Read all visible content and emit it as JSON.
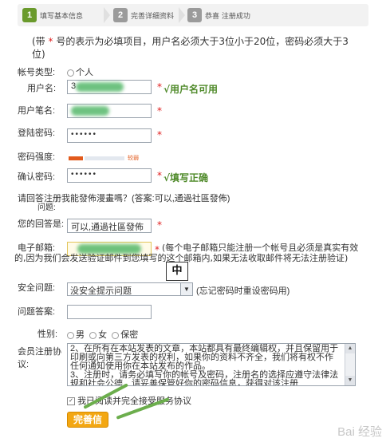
{
  "steps": [
    {
      "num": "1",
      "label": "填写基本信息",
      "state": "active"
    },
    {
      "num": "2",
      "label": "完善详细资料",
      "state": "pending"
    },
    {
      "num": "3",
      "label": "恭喜  注册成功",
      "state": "pending"
    }
  ],
  "note": {
    "before": "(带 ",
    "star": "*",
    "after": " 号的表示为必填项目，用户名必须大于3位小于20位，密码必须大于3位)"
  },
  "account_type": {
    "label": "帐号类型:",
    "value": "个人"
  },
  "username": {
    "label": "用户名:",
    "value": "3",
    "required": "*",
    "status": "√用户名可用"
  },
  "nickname": {
    "label": "用户笔名:",
    "required": "*"
  },
  "password": {
    "label": "登陆密码:",
    "value": "••••••",
    "required": "*"
  },
  "strength": {
    "label": "密码强度:",
    "level_text": "较弱",
    "level": 0.33
  },
  "confirm": {
    "label": "确认密码:",
    "value": "••••••",
    "required": "*",
    "status": "√填写正确"
  },
  "question": {
    "text": "请回答注册我能發佈漫畫嗎？(答案:可以,通過社區發佈)",
    "sub": "问题:"
  },
  "answer": {
    "label": "您的回答是:",
    "value": "可以,通過社區發佈",
    "required": "*"
  },
  "email": {
    "label": "电子邮箱:",
    "required": "*",
    "note": "(每个电子邮箱只能注册一个帐号且必须是真实有效的,因为我们会发送验证邮件到您填写的这个邮箱内,如果无法收取邮件将无法注册验证)"
  },
  "ime_badge": "中",
  "security_question": {
    "label": "安全问题:",
    "value": "没安全提示问题",
    "hint": "(忘记密码时重设密码用)"
  },
  "security_answer": {
    "label": "问题答案:"
  },
  "gender": {
    "label": "性别:",
    "options": [
      "男",
      "女",
      "保密"
    ]
  },
  "agreement": {
    "label": "会员注册协议:",
    "text": "2、在所有在本站发表的文章，本站都具有最终编辑权，并且保留用于印刷或向第三方发表的权利，如果你的资料不齐全，我们将有权不作任何通知使用你在本站发布的作品。\n3、注册时，请务必填写你的帐号及密码，注册名的选择应遵守法律法规和社会公德，请妥善保管好你的密码信息，获得对该注册"
  },
  "agree": {
    "text": "我已阅读并完全接受服务协议"
  },
  "submit_label": "完善信",
  "watermark": "Bai 经验",
  "colors": {
    "accent_green": "#6a9a2c",
    "required_red": "#e02020",
    "submit_orange": "#f3a712"
  }
}
